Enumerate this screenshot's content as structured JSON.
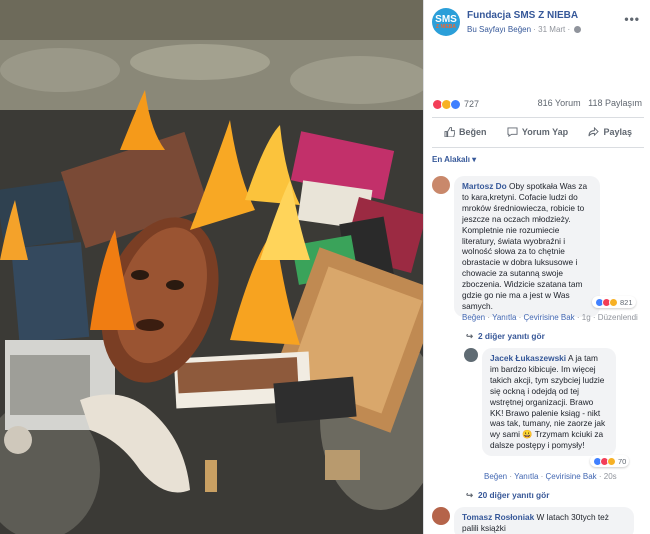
{
  "post": {
    "page_name": "Fundacja SMS Z NIEBA",
    "avatar_line1": "SMS",
    "avatar_line2": "Z NIEBA",
    "like_page": "Bu Sayfayı Beğen",
    "date": "31 Mart",
    "more": "•••"
  },
  "stats": {
    "reaction_count": "727",
    "comments": "816 Yorum",
    "shares": "118 Paylaşım"
  },
  "actions": {
    "like": "Beğen",
    "comment": "Yorum Yap",
    "share": "Paylaş"
  },
  "sort": {
    "label": "En Alakalı ▾"
  },
  "comments": [
    {
      "author": "Martosz Do",
      "text": "Oby spotkała Was za to kara,kretyni. Cofacie ludzi do mroków średniowiecza, robicie to jeszcze na oczach młodzieży. Kompletnie nie rozumiecie literatury, świata wyobraźni i wolność słowa za to chętnie obrastacie w dobra luksusowe i chowacie za sutanną swoje zboczenia. Widzicie szatana tam gdzie go nie ma a jest w Was samych.",
      "reactions": "821",
      "like": "Beğen",
      "reply": "Yanıtla",
      "translate": "Çevirisine Bak",
      "time": "1g",
      "edited": "Düzenlendi",
      "more_replies": "2 diğer yanıtı gör"
    },
    {
      "author": "Jacek Łukaszewski",
      "text": "A ja tam im bardzo kibicuje. Im więcej takich akcji, tym szybciej ludzie się ockną i odejdą od tej wstrętnej organizacji. Brawo KK! Brawo palenie ksiąg - nikt was tak, tumany, nie zaorze jak wy sami 😀 Trzymam kciuki za dalsze postępy i pomysły!",
      "reactions": "70",
      "like": "Beğen",
      "reply": "Yanıtla",
      "translate": "Çevirisine Bak",
      "time": "20s",
      "more_replies": "20 diğer yanıtı gör"
    },
    {
      "author": "Tomasz Rosłoniak",
      "text": "W latach 30tych też palili książki"
    }
  ],
  "colors": {
    "link": "#365899",
    "bubble": "#f2f3f5",
    "muted": "#90949c"
  }
}
